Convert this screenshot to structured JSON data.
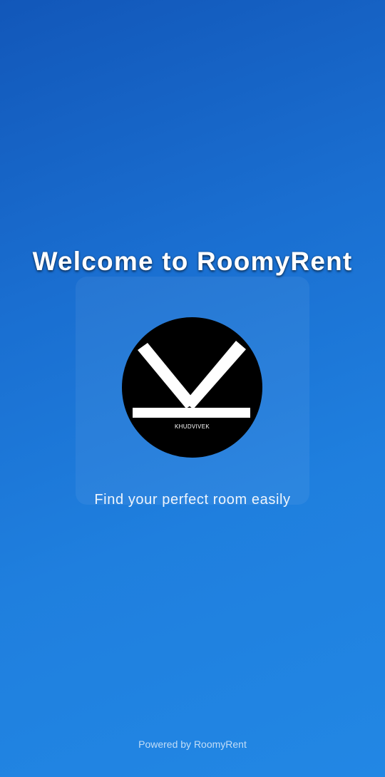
{
  "splash": {
    "title": "Welcome to RoomyRent",
    "logo_text": "KHUDVIVEK",
    "tagline": "Find your perfect room easily",
    "footer": "Powered by RoomyRent"
  },
  "colors": {
    "background_top": "#1257b9",
    "background_bottom": "#2287e4",
    "logo_background": "#000000",
    "logo_mark": "#ffffff",
    "text": "#ffffff"
  },
  "icons": {
    "logo": "k-monogram-logo"
  }
}
